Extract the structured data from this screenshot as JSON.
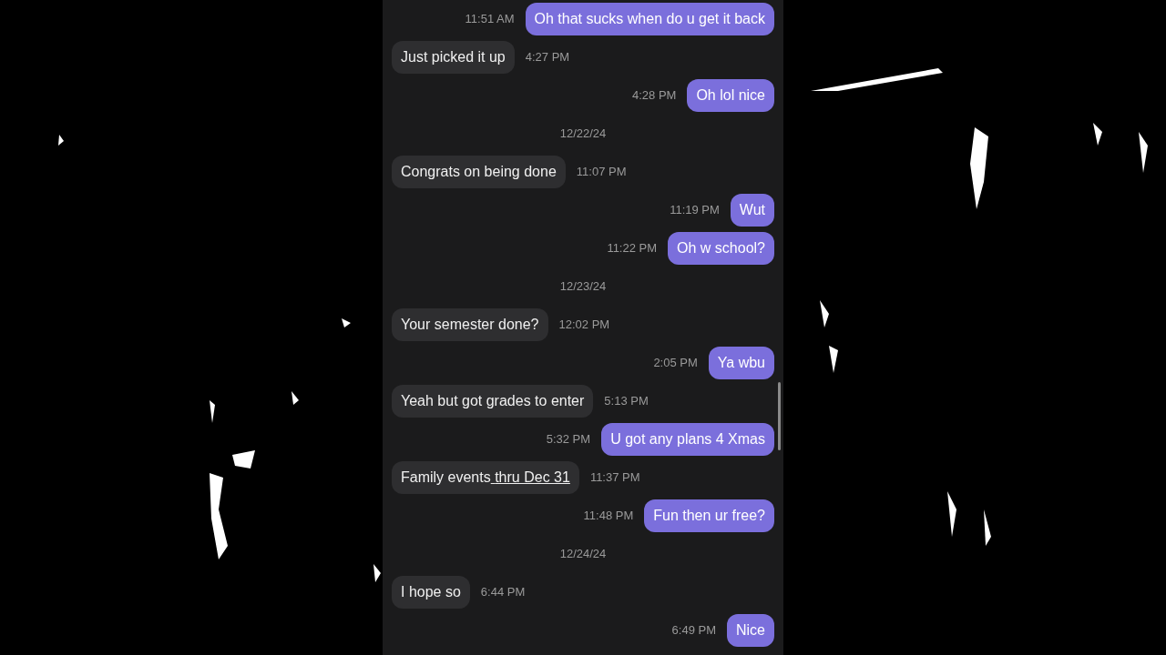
{
  "messages": [
    {
      "kind": "outgoing",
      "text": "Oh that sucks when do u get it back",
      "time": "11:51 AM"
    },
    {
      "kind": "incoming",
      "text": "Just picked it up",
      "time": "4:27 PM"
    },
    {
      "kind": "outgoing",
      "text": "Oh lol nice",
      "time": "4:28 PM"
    },
    {
      "kind": "date",
      "text": "12/22/24"
    },
    {
      "kind": "incoming",
      "text": "Congrats on being done",
      "time": "11:07 PM"
    },
    {
      "kind": "outgoing",
      "text": "Wut",
      "time": "11:19 PM"
    },
    {
      "kind": "outgoing",
      "text": "Oh w school?",
      "time": "11:22 PM"
    },
    {
      "kind": "date",
      "text": "12/23/24"
    },
    {
      "kind": "incoming",
      "text": "Your semester done?",
      "time": "12:02 PM"
    },
    {
      "kind": "outgoing",
      "text": "Ya wbu",
      "time": "2:05 PM"
    },
    {
      "kind": "incoming",
      "text": "Yeah but got grades to enter",
      "time": "5:13 PM"
    },
    {
      "kind": "outgoing",
      "text": "U got any plans 4 Xmas",
      "time": "5:32 PM"
    },
    {
      "kind": "incoming",
      "text": "Family events",
      "link": "thru Dec 31",
      "time": "11:37 PM"
    },
    {
      "kind": "outgoing",
      "text": "Fun then ur free?",
      "time": "11:48 PM"
    },
    {
      "kind": "date",
      "text": "12/24/24"
    },
    {
      "kind": "incoming",
      "text": "I hope so",
      "time": "6:44 PM"
    },
    {
      "kind": "outgoing",
      "text": "Nice",
      "time": "6:49 PM"
    }
  ]
}
